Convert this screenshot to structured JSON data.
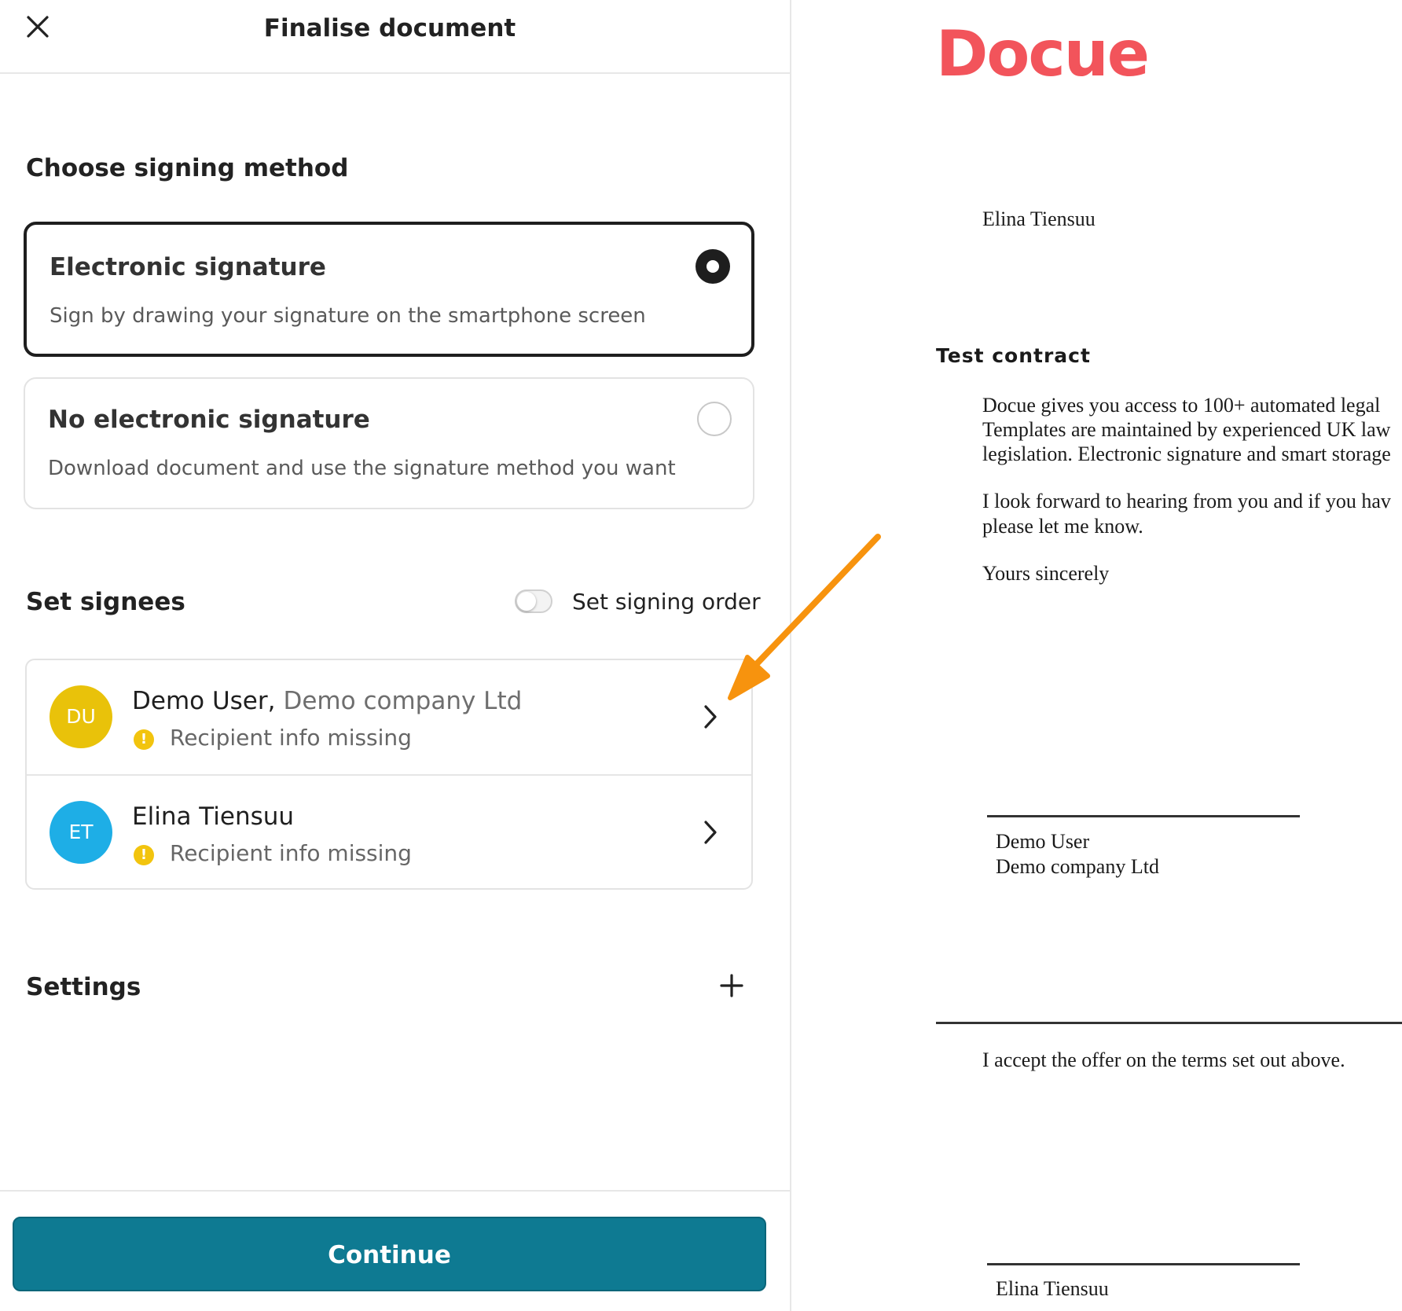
{
  "header": {
    "title": "Finalise document"
  },
  "signing_method": {
    "heading": "Choose signing method",
    "options": [
      {
        "title": "Electronic signature",
        "description": "Sign by drawing your signature on the smartphone screen",
        "selected": true
      },
      {
        "title": "No electronic signature",
        "description": "Download document and use the signature method you want",
        "selected": false
      }
    ]
  },
  "signees": {
    "heading": "Set signees",
    "order_toggle_label": "Set signing order",
    "order_toggle_on": false,
    "list": [
      {
        "initials": "DU",
        "name": "Demo User,",
        "company": "Demo company Ltd",
        "status": "Recipient info missing",
        "avatar_color": "#e9c20a"
      },
      {
        "initials": "ET",
        "name": "Elina Tiensuu",
        "company": "",
        "status": "Recipient info missing",
        "avatar_color": "#1eaee6"
      }
    ]
  },
  "settings": {
    "heading": "Settings"
  },
  "footer": {
    "continue_label": "Continue"
  },
  "document": {
    "logo": "Docue",
    "recipient": "Elina Tiensuu",
    "title": "Test contract",
    "paragraph1": [
      "Docue gives you access to 100+ automated legal",
      "Templates are maintained by experienced UK law",
      "legislation. Electronic signature and smart storage"
    ],
    "paragraph2": [
      "I look forward to hearing from you and if you hav",
      "please let me know."
    ],
    "closing": "Yours sincerely",
    "signer1_name": "Demo User",
    "signer1_company": "Demo company Ltd",
    "acceptance": "I accept the offer on the terms set out above.",
    "signer2_name": "Elina Tiensuu"
  },
  "colors": {
    "accent": "#0e7a92",
    "brand": "#f2545b",
    "warning": "#f2c40e",
    "arrow": "#f7930e"
  }
}
